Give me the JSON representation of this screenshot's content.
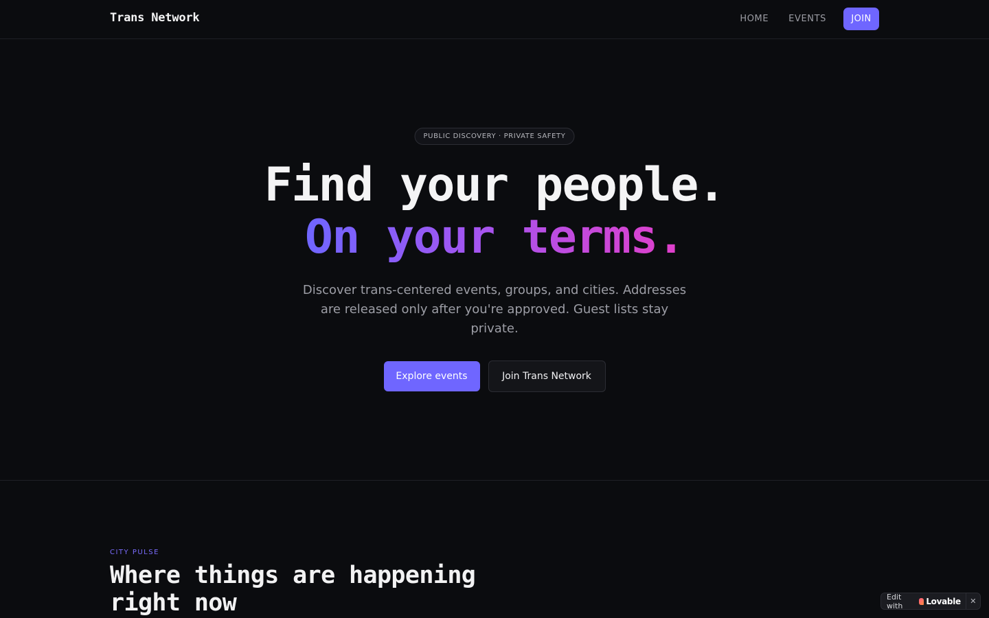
{
  "header": {
    "brand": "Trans Network",
    "nav": {
      "home": "HOME",
      "events": "EVENTS",
      "join": "JOIN"
    }
  },
  "hero": {
    "pill": "PUBLIC DISCOVERY · PRIVATE SAFETY",
    "headline_line1": "Find your people.",
    "headline_line2": "On your terms.",
    "subtext": "Discover trans-centered events, groups, and cities. Addresses are released only after you're approved. Guest lists stay private.",
    "primary_cta": "Explore events",
    "secondary_cta": "Join Trans Network"
  },
  "city_pulse": {
    "eyebrow": "CITY PULSE",
    "title": "Where things are happening right now"
  },
  "badge": {
    "prefix": "Edit with",
    "brand": "Lovable",
    "close": "✕"
  },
  "colors": {
    "background": "#0b0c0f",
    "accent": "#6f66ff",
    "gradient_end": "#e23fc9",
    "muted_text": "#9d9ea6"
  }
}
